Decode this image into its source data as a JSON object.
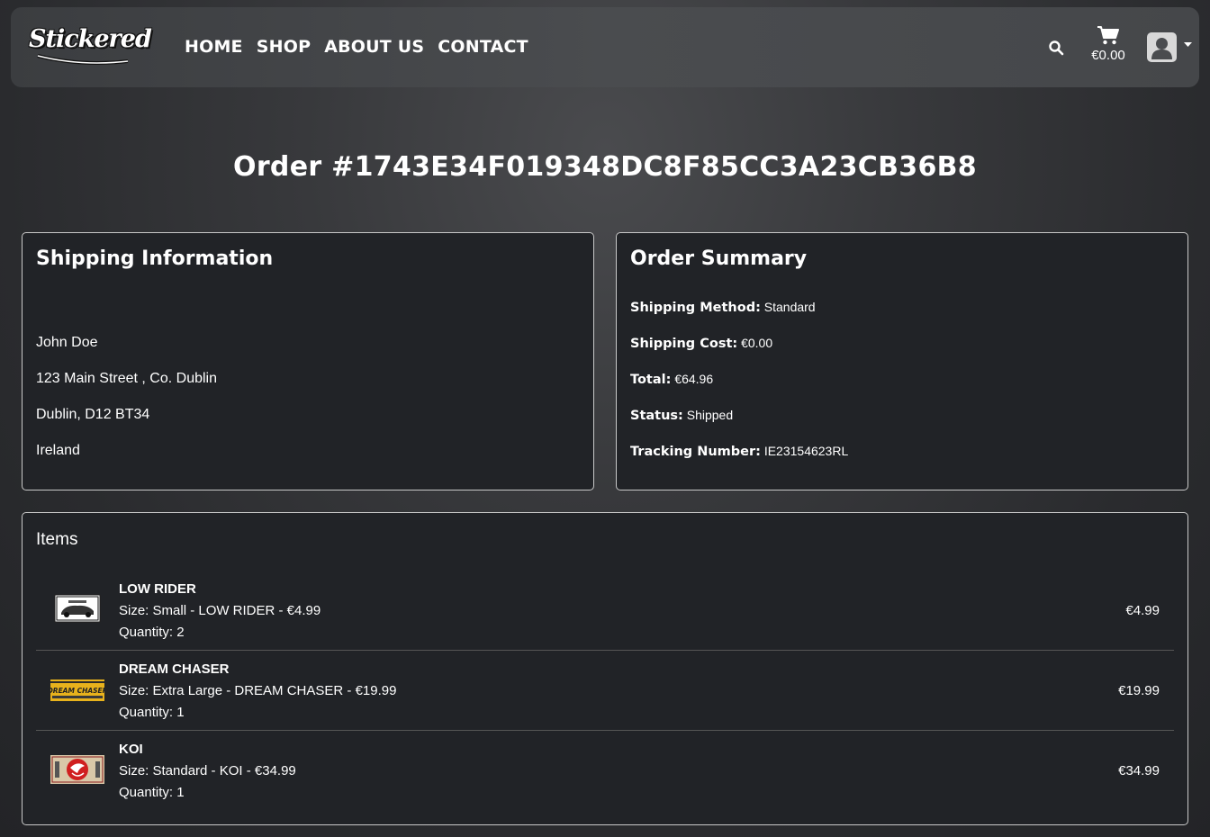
{
  "header": {
    "logo_text": "Stickered",
    "nav": [
      "HOME",
      "SHOP",
      "ABOUT US",
      "CONTACT"
    ],
    "cart_total": "€0.00",
    "icons": [
      "search-icon",
      "cart-icon",
      "user-avatar-icon",
      "caret-down-icon"
    ]
  },
  "page_title": "Order #1743E34F019348DC8F85CC3A23CB36B8",
  "shipping": {
    "title": "Shipping Information",
    "name": "John Doe",
    "street": "123 Main Street , Co. Dublin",
    "city": "Dublin, D12 BT34",
    "country": "Ireland"
  },
  "summary": {
    "title": "Order Summary",
    "rows": [
      {
        "label": "Shipping Method:",
        "value": "Standard"
      },
      {
        "label": "Shipping Cost:",
        "value": "€0.00"
      },
      {
        "label": "Total:",
        "value": "€64.96"
      },
      {
        "label": "Status:",
        "value": "Shipped"
      },
      {
        "label": "Tracking Number:",
        "value": "IE23154623RL"
      }
    ]
  },
  "items": {
    "title": "Items",
    "list": [
      {
        "name": "LOW RIDER",
        "detail": "Size: Small - LOW RIDER - €4.99",
        "quantity": "Quantity: 2",
        "price": "€4.99"
      },
      {
        "name": "DREAM CHASER",
        "detail": "Size: Extra Large - DREAM CHASER - €19.99",
        "quantity": "Quantity: 1",
        "price": "€19.99",
        "thumb_text": "DREAM CHASER"
      },
      {
        "name": "KOI",
        "detail": "Size: Standard - KOI - €34.99",
        "quantity": "Quantity: 1",
        "price": "€34.99"
      }
    ]
  },
  "colors": {
    "background": "#2e2f32",
    "navbar": "#45474a",
    "card": "#212327",
    "card_border": "#c9c9c9",
    "text": "#ffffff"
  }
}
